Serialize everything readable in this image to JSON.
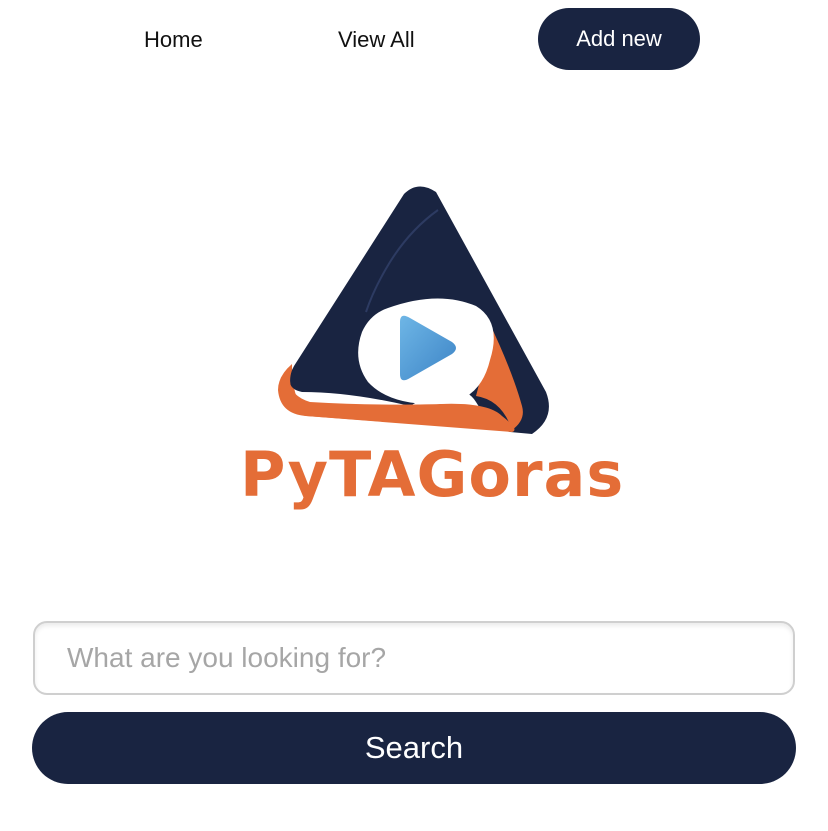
{
  "nav": {
    "home_label": "Home",
    "view_all_label": "View All",
    "add_new_label": "Add new"
  },
  "logo": {
    "wordmark": "PyTAGoras",
    "icon": "play-triangle-logo"
  },
  "search": {
    "placeholder": "What are you looking for?",
    "value": "",
    "button_label": "Search"
  },
  "colors": {
    "navy": "#192441",
    "orange": "#e46d37",
    "play_blue": "#4d97d3"
  }
}
